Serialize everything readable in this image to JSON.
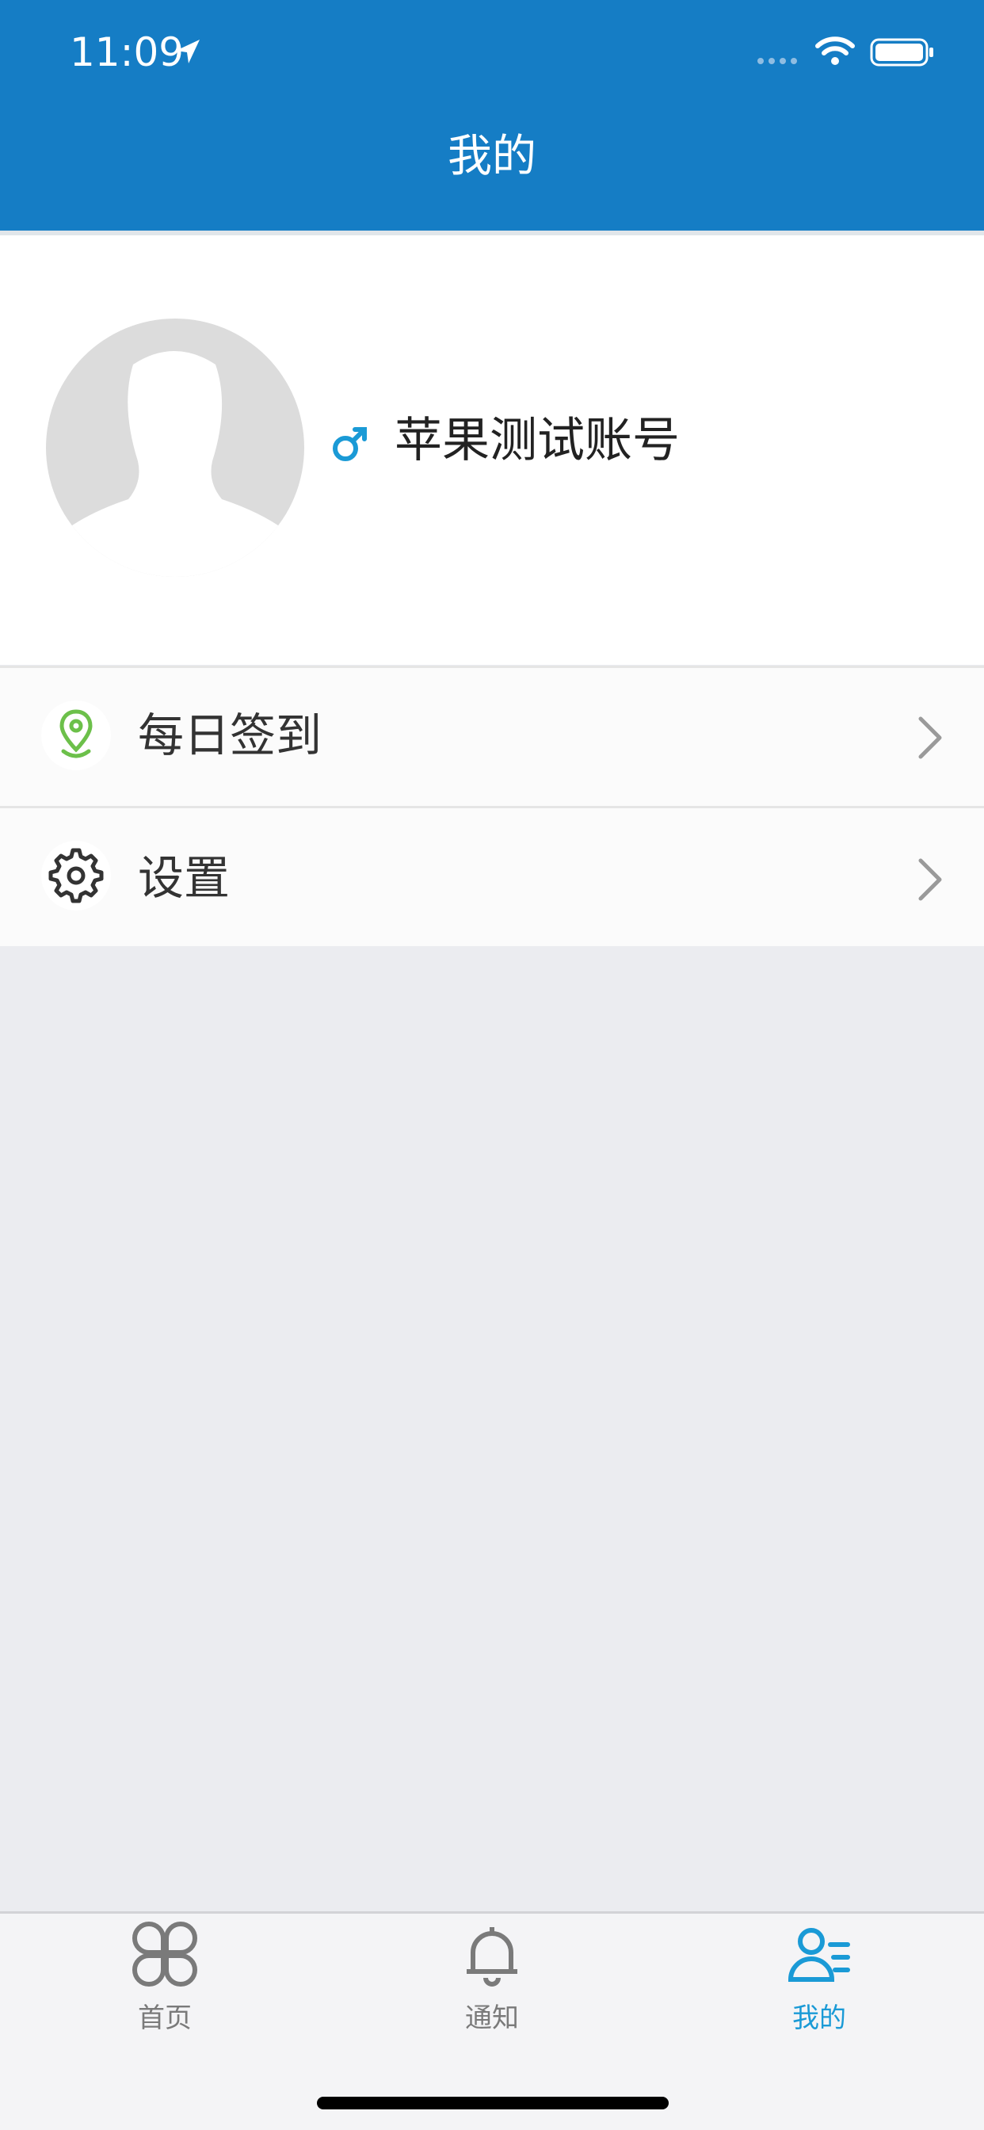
{
  "status_bar": {
    "time": "11:09"
  },
  "header": {
    "title": "我的"
  },
  "profile": {
    "gender_symbol": "♂",
    "name": "苹果测试账号"
  },
  "menu": {
    "items": [
      {
        "label": "每日签到",
        "icon": "location-pin-icon"
      },
      {
        "label": "设置",
        "icon": "gear-icon"
      }
    ]
  },
  "tabbar": {
    "tabs": [
      {
        "label": "首页",
        "icon": "clover-grid-icon",
        "active": false
      },
      {
        "label": "通知",
        "icon": "bell-icon",
        "active": false
      },
      {
        "label": "我的",
        "icon": "user-list-icon",
        "active": true
      }
    ]
  },
  "colors": {
    "primary": "#157dc5",
    "active_tab": "#1a9ad6",
    "inactive_tab": "#7a7a7a",
    "checkin_icon": "#6cc04a"
  }
}
